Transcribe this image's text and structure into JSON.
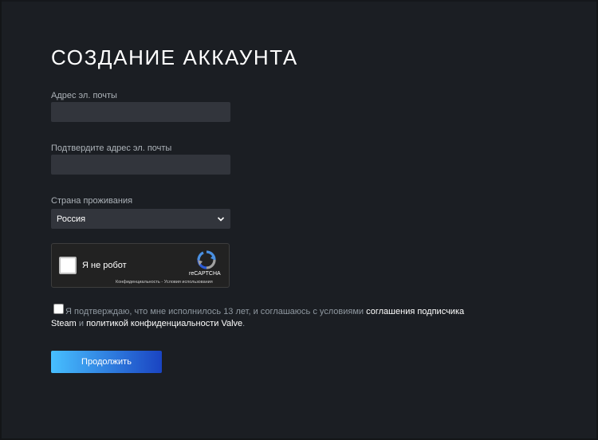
{
  "page": {
    "title": "СОЗДАНИЕ АККАУНТА"
  },
  "form": {
    "email_label": "Адрес эл. почты",
    "email_value": "",
    "confirm_email_label": "Подтвердите адрес эл. почты",
    "confirm_email_value": "",
    "country_label": "Страна проживания",
    "country_selected": "Россия"
  },
  "captcha": {
    "checkbox_label": "Я не робот",
    "brand": "reCAPTCHA",
    "privacy_link": "Конфиденциальность",
    "separator": " - ",
    "terms_link": "Условия использования"
  },
  "agreement": {
    "text_part1": "Я подтверждаю, что мне исполнилось 13 лет, и соглашаюсь с условиями ",
    "link1": "соглашения подписчика Steam",
    "text_part2": " и ",
    "link2": "политикой конфиденциальности Valve",
    "text_part3": "."
  },
  "actions": {
    "continue_label": "Продолжить"
  },
  "colors": {
    "background": "#1b1e23",
    "input_bg": "#32353c",
    "button_gradient_start": "#47bfff",
    "button_gradient_end": "#1a44c2"
  },
  "icons": {
    "recaptcha_logo": "recaptcha-logo-icon",
    "select_chevron": "chevron-down-icon"
  }
}
